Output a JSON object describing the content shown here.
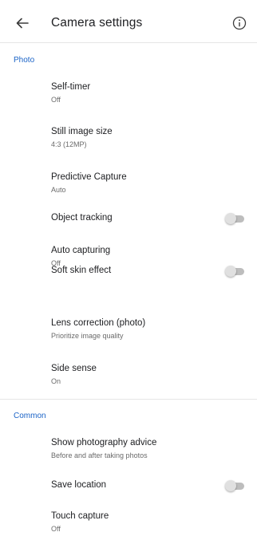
{
  "header": {
    "title": "Camera settings"
  },
  "icons": {
    "back": "arrow-back-icon",
    "info": "info-circle-icon"
  },
  "colors": {
    "accent": "#1a63c7",
    "toggle_off_track": "#bdbdbd",
    "toggle_off_thumb": "#e0e0e0"
  },
  "photo": {
    "header": "Photo",
    "items": [
      {
        "title": "Self-timer",
        "summary": "Off"
      },
      {
        "title": "Still image size",
        "summary": "4:3 (12MP)"
      },
      {
        "title": "Predictive Capture",
        "summary": "Auto"
      },
      {
        "title": "Object tracking",
        "toggle": false
      },
      {
        "title": "Auto capturing",
        "summary": "Off"
      },
      {
        "title": "Soft skin effect",
        "toggle": false
      },
      {
        "title": "Lens correction (photo)",
        "summary": "Prioritize image quality"
      },
      {
        "title": "Side sense",
        "summary": "On"
      }
    ]
  },
  "common": {
    "header": "Common",
    "items": [
      {
        "title": "Show photography advice",
        "summary": "Before and after taking photos"
      },
      {
        "title": "Save location",
        "toggle": false
      },
      {
        "title": "Touch capture",
        "summary": "Off"
      }
    ]
  }
}
